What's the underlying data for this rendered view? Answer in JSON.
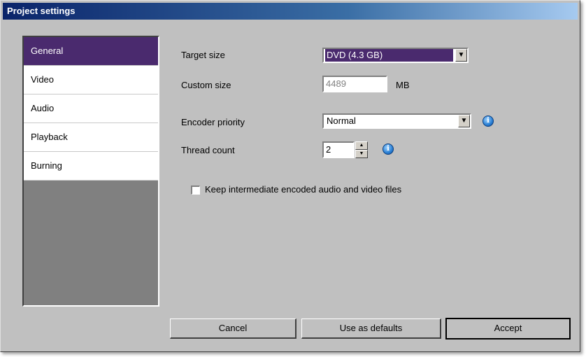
{
  "window": {
    "title": "Project settings"
  },
  "sidebar": {
    "items": [
      {
        "label": "General"
      },
      {
        "label": "Video"
      },
      {
        "label": "Audio"
      },
      {
        "label": "Playback"
      },
      {
        "label": "Burning"
      }
    ]
  },
  "settings": {
    "target_size": {
      "label": "Target size",
      "value": "DVD (4.3 GB)"
    },
    "custom_size": {
      "label": "Custom size",
      "value": "4489",
      "unit": "MB"
    },
    "encoder_priority": {
      "label": "Encoder priority",
      "value": "Normal"
    },
    "thread_count": {
      "label": "Thread count",
      "value": "2"
    },
    "keep_intermediate": {
      "label": "Keep intermediate encoded audio and video files",
      "checked": false
    }
  },
  "buttons": {
    "cancel": "Cancel",
    "use_as_defaults": "Use as defaults",
    "accept": "Accept"
  },
  "icons": {
    "info": "info-icon",
    "dropdown": "chevron-down-icon",
    "spin_up": "arrow-up-icon",
    "spin_down": "arrow-down-icon"
  },
  "colors": {
    "title_gradient_start": "#0a246a",
    "selection": "#4a2a6e",
    "face": "#c0c0c0"
  }
}
